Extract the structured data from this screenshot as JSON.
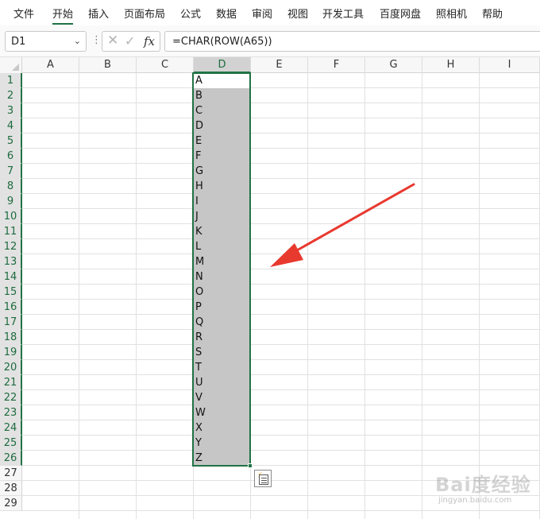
{
  "menu": {
    "items": [
      "文件",
      "开始",
      "插入",
      "页面布局",
      "公式",
      "数据",
      "审阅",
      "视图",
      "开发工具",
      "百度网盘",
      "照相机",
      "帮助"
    ],
    "active": "开始"
  },
  "formula_bar": {
    "name_box": "D1",
    "formula": "=CHAR(ROW(A65))",
    "fx_label": "fx",
    "cancel_icon": "cross-icon",
    "enter_icon": "check-icon"
  },
  "sheet": {
    "columns": [
      "A",
      "B",
      "C",
      "D",
      "E",
      "F",
      "G",
      "H",
      "I"
    ],
    "selected_column": "D",
    "rows": [
      "1",
      "2",
      "3",
      "4",
      "5",
      "6",
      "7",
      "8",
      "9",
      "10",
      "11",
      "12",
      "13",
      "14",
      "15",
      "16",
      "17",
      "18",
      "19",
      "20",
      "21",
      "22",
      "23",
      "24",
      "25",
      "26",
      "27",
      "28",
      "29"
    ],
    "selected_range": "D1:D26",
    "column_d_values": [
      "A",
      "B",
      "C",
      "D",
      "E",
      "F",
      "G",
      "H",
      "I",
      "J",
      "K",
      "L",
      "M",
      "N",
      "O",
      "P",
      "Q",
      "R",
      "S",
      "T",
      "U",
      "V",
      "W",
      "X",
      "Y",
      "Z"
    ]
  },
  "annotation": {
    "arrow_color": "#e8392f"
  },
  "quick_analysis": {
    "icon": "quick-analysis-icon"
  },
  "watermark": {
    "logo": "Bai度经验",
    "url": "jingyan.baidu.com"
  },
  "colors": {
    "accent": "#217346",
    "selection": "#c6c6c6"
  }
}
